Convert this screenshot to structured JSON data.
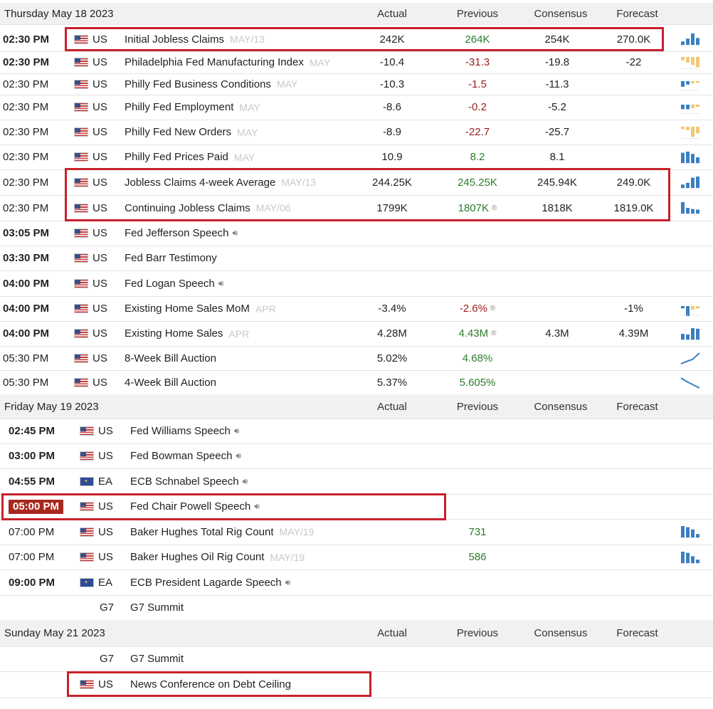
{
  "sections": [
    {
      "date": "Thursday May 18 2023",
      "headers": {
        "actual": "Actual",
        "previous": "Previous",
        "consensus": "Consensus",
        "forecast": "Forecast"
      },
      "rows": [
        {
          "time": "02:30 PM",
          "bold": true,
          "country": "US",
          "event": "Initial Jobless Claims",
          "period": "MAY/13",
          "actual": "242K",
          "previous": "264K",
          "prev_color": "green",
          "consensus": "254K",
          "forecast": "270.0K",
          "spark": "bars-up",
          "spark_bars": [
            0.3,
            0.55,
            1.0,
            0.6
          ]
        },
        {
          "time": "02:30 PM",
          "bold": true,
          "country": "US",
          "event": "Philadelphia Fed Manufacturing Index",
          "period": "MAY",
          "actual": "-10.4",
          "previous": "-31.3",
          "prev_color": "red",
          "consensus": "-19.8",
          "forecast": "-22",
          "spark": "bars-down-orange",
          "spark_bars": [
            0.3,
            0.5,
            0.7,
            0.9
          ]
        },
        {
          "time": "02:30 PM",
          "bold": false,
          "country": "US",
          "event": "Philly Fed Business Conditions",
          "period": "MAY",
          "actual": "-10.3",
          "previous": "-1.5",
          "prev_color": "red",
          "consensus": "-11.3",
          "forecast": "",
          "spark": "mixed",
          "spark_bars": [
            0.5,
            0.3,
            0.2,
            0.15
          ]
        },
        {
          "time": "02:30 PM",
          "bold": false,
          "country": "US",
          "event": "Philly Fed Employment",
          "period": "MAY",
          "actual": "-8.6",
          "previous": "-0.2",
          "prev_color": "red",
          "consensus": "-5.2",
          "forecast": "",
          "spark": "mixed",
          "spark_bars": [
            0.4,
            0.4,
            0.3,
            0.2
          ]
        },
        {
          "time": "02:30 PM",
          "bold": false,
          "country": "US",
          "event": "Philly Fed New Orders",
          "period": "MAY",
          "actual": "-8.9",
          "previous": "-22.7",
          "prev_color": "red",
          "consensus": "-25.7",
          "forecast": "",
          "spark": "bars-down-orange",
          "spark_bars": [
            0.2,
            0.3,
            0.9,
            0.6
          ]
        },
        {
          "time": "02:30 PM",
          "bold": false,
          "country": "US",
          "event": "Philly Fed Prices Paid",
          "period": "MAY",
          "actual": "10.9",
          "previous": "8.2",
          "prev_color": "green",
          "consensus": "8.1",
          "forecast": "",
          "spark": "bars-up",
          "spark_bars": [
            0.9,
            1.0,
            0.8,
            0.5
          ]
        },
        {
          "time": "02:30 PM",
          "bold": false,
          "country": "US",
          "event": "Jobless Claims 4-week Average",
          "period": "MAY/13",
          "actual": "244.25K",
          "previous": "245.25K",
          "prev_color": "green",
          "consensus": "245.94K",
          "forecast": "249.0K",
          "spark": "bars-up",
          "spark_bars": [
            0.3,
            0.45,
            0.9,
            1.0
          ]
        },
        {
          "time": "02:30 PM",
          "bold": false,
          "country": "US",
          "event": "Continuing Jobless Claims",
          "period": "MAY/06",
          "actual": "1799K",
          "previous": "1807K",
          "prev_color": "green",
          "prev_revised": true,
          "consensus": "1818K",
          "forecast": "1819.0K",
          "spark": "bars-down",
          "spark_bars": [
            1.0,
            0.5,
            0.4,
            0.35
          ]
        },
        {
          "time": "03:05 PM",
          "bold": true,
          "country": "US",
          "event": "Fed Jefferson Speech",
          "speech": true,
          "actual": "",
          "previous": "",
          "consensus": "",
          "forecast": ""
        },
        {
          "time": "03:30 PM",
          "bold": true,
          "country": "US",
          "event": "Fed Barr Testimony",
          "actual": "",
          "previous": "",
          "consensus": "",
          "forecast": ""
        },
        {
          "time": "04:00 PM",
          "bold": true,
          "country": "US",
          "event": "Fed Logan Speech",
          "speech": true,
          "actual": "",
          "previous": "",
          "consensus": "",
          "forecast": ""
        },
        {
          "time": "04:00 PM",
          "bold": true,
          "country": "US",
          "event": "Existing Home Sales MoM",
          "period": "APR",
          "actual": "-3.4%",
          "previous": "-2.6%",
          "prev_color": "red",
          "prev_revised": true,
          "consensus": "",
          "forecast": "-1%",
          "spark": "mixed",
          "spark_bars": [
            0.2,
            1.0,
            0.3,
            0.2
          ]
        },
        {
          "time": "04:00 PM",
          "bold": true,
          "country": "US",
          "event": "Existing Home Sales",
          "period": "APR",
          "actual": "4.28M",
          "previous": "4.43M",
          "prev_color": "green",
          "prev_revised": true,
          "consensus": "4.3M",
          "forecast": "4.39M",
          "spark": "bars-up",
          "spark_bars": [
            0.5,
            0.45,
            1.0,
            0.95
          ]
        },
        {
          "time": "05:30 PM",
          "bold": false,
          "country": "US",
          "event": "8-Week Bill Auction",
          "actual": "5.02%",
          "previous": "4.68%",
          "prev_color": "green",
          "consensus": "",
          "forecast": "",
          "spark": "line-up"
        },
        {
          "time": "05:30 PM",
          "bold": false,
          "country": "US",
          "event": "4-Week Bill Auction",
          "actual": "5.37%",
          "previous": "5.605%",
          "prev_color": "green",
          "consensus": "",
          "forecast": "",
          "spark": "line-down"
        }
      ]
    },
    {
      "date": "Friday May 19 2023",
      "headers": {
        "actual": "Actual",
        "previous": "Previous",
        "consensus": "Consensus",
        "forecast": "Forecast"
      },
      "rows": [
        {
          "time": "02:45 PM",
          "bold": true,
          "country": "US",
          "event": "Fed Williams Speech",
          "speech": true,
          "actual": "",
          "previous": "",
          "consensus": "",
          "forecast": ""
        },
        {
          "time": "03:00 PM",
          "bold": true,
          "country": "US",
          "event": "Fed Bowman Speech",
          "speech": true,
          "actual": "",
          "previous": "",
          "consensus": "",
          "forecast": ""
        },
        {
          "time": "04:55 PM",
          "bold": true,
          "country": "EA",
          "event": "ECB Schnabel Speech",
          "speech": true,
          "actual": "",
          "previous": "",
          "consensus": "",
          "forecast": ""
        },
        {
          "time": "05:00 PM",
          "bold": true,
          "highlight": true,
          "country": "US",
          "event": "Fed Chair Powell Speech",
          "speech": true,
          "actual": "",
          "previous": "",
          "consensus": "",
          "forecast": ""
        },
        {
          "time": "07:00 PM",
          "bold": false,
          "country": "US",
          "event": "Baker Hughes Total Rig Count",
          "period": "MAY/19",
          "actual": "",
          "previous": "731",
          "prev_color": "green",
          "consensus": "",
          "forecast": "",
          "spark": "bars-down",
          "spark_bars": [
            1.0,
            0.9,
            0.7,
            0.3
          ]
        },
        {
          "time": "07:00 PM",
          "bold": false,
          "country": "US",
          "event": "Baker Hughes Oil Rig Count",
          "period": "MAY/19",
          "actual": "",
          "previous": "586",
          "prev_color": "green",
          "consensus": "",
          "forecast": "",
          "spark": "bars-down",
          "spark_bars": [
            1.0,
            0.9,
            0.6,
            0.3
          ]
        },
        {
          "time": "09:00 PM",
          "bold": true,
          "country": "EA",
          "event": "ECB President Lagarde Speech",
          "speech": true,
          "actual": "",
          "previous": "",
          "consensus": "",
          "forecast": ""
        },
        {
          "time": "",
          "bold": false,
          "country": "G7",
          "event": "G7 Summit",
          "actual": "",
          "previous": "",
          "consensus": "",
          "forecast": ""
        }
      ]
    },
    {
      "date": "Sunday May 21 2023",
      "headers": {
        "actual": "Actual",
        "previous": "Previous",
        "consensus": "Consensus",
        "forecast": "Forecast"
      },
      "rows": [
        {
          "time": "",
          "bold": false,
          "country": "G7",
          "event": "G7 Summit",
          "actual": "",
          "previous": "",
          "consensus": "",
          "forecast": ""
        },
        {
          "time": "",
          "bold": false,
          "country": "US",
          "event": "News Conference on Debt Ceiling",
          "actual": "",
          "previous": "",
          "consensus": "",
          "forecast": ""
        }
      ]
    }
  ],
  "speaker_icon": "speaker-icon",
  "revised_icon": "revised-icon",
  "revised_glyph": "®",
  "colors": {
    "highlight_box": "#c8202b",
    "green": "#2b7d2b",
    "red": "#9b1c1c",
    "spark_blue": "#3b7fc0",
    "spark_orange": "#f2c878",
    "header_bg": "#f1f1f1"
  }
}
